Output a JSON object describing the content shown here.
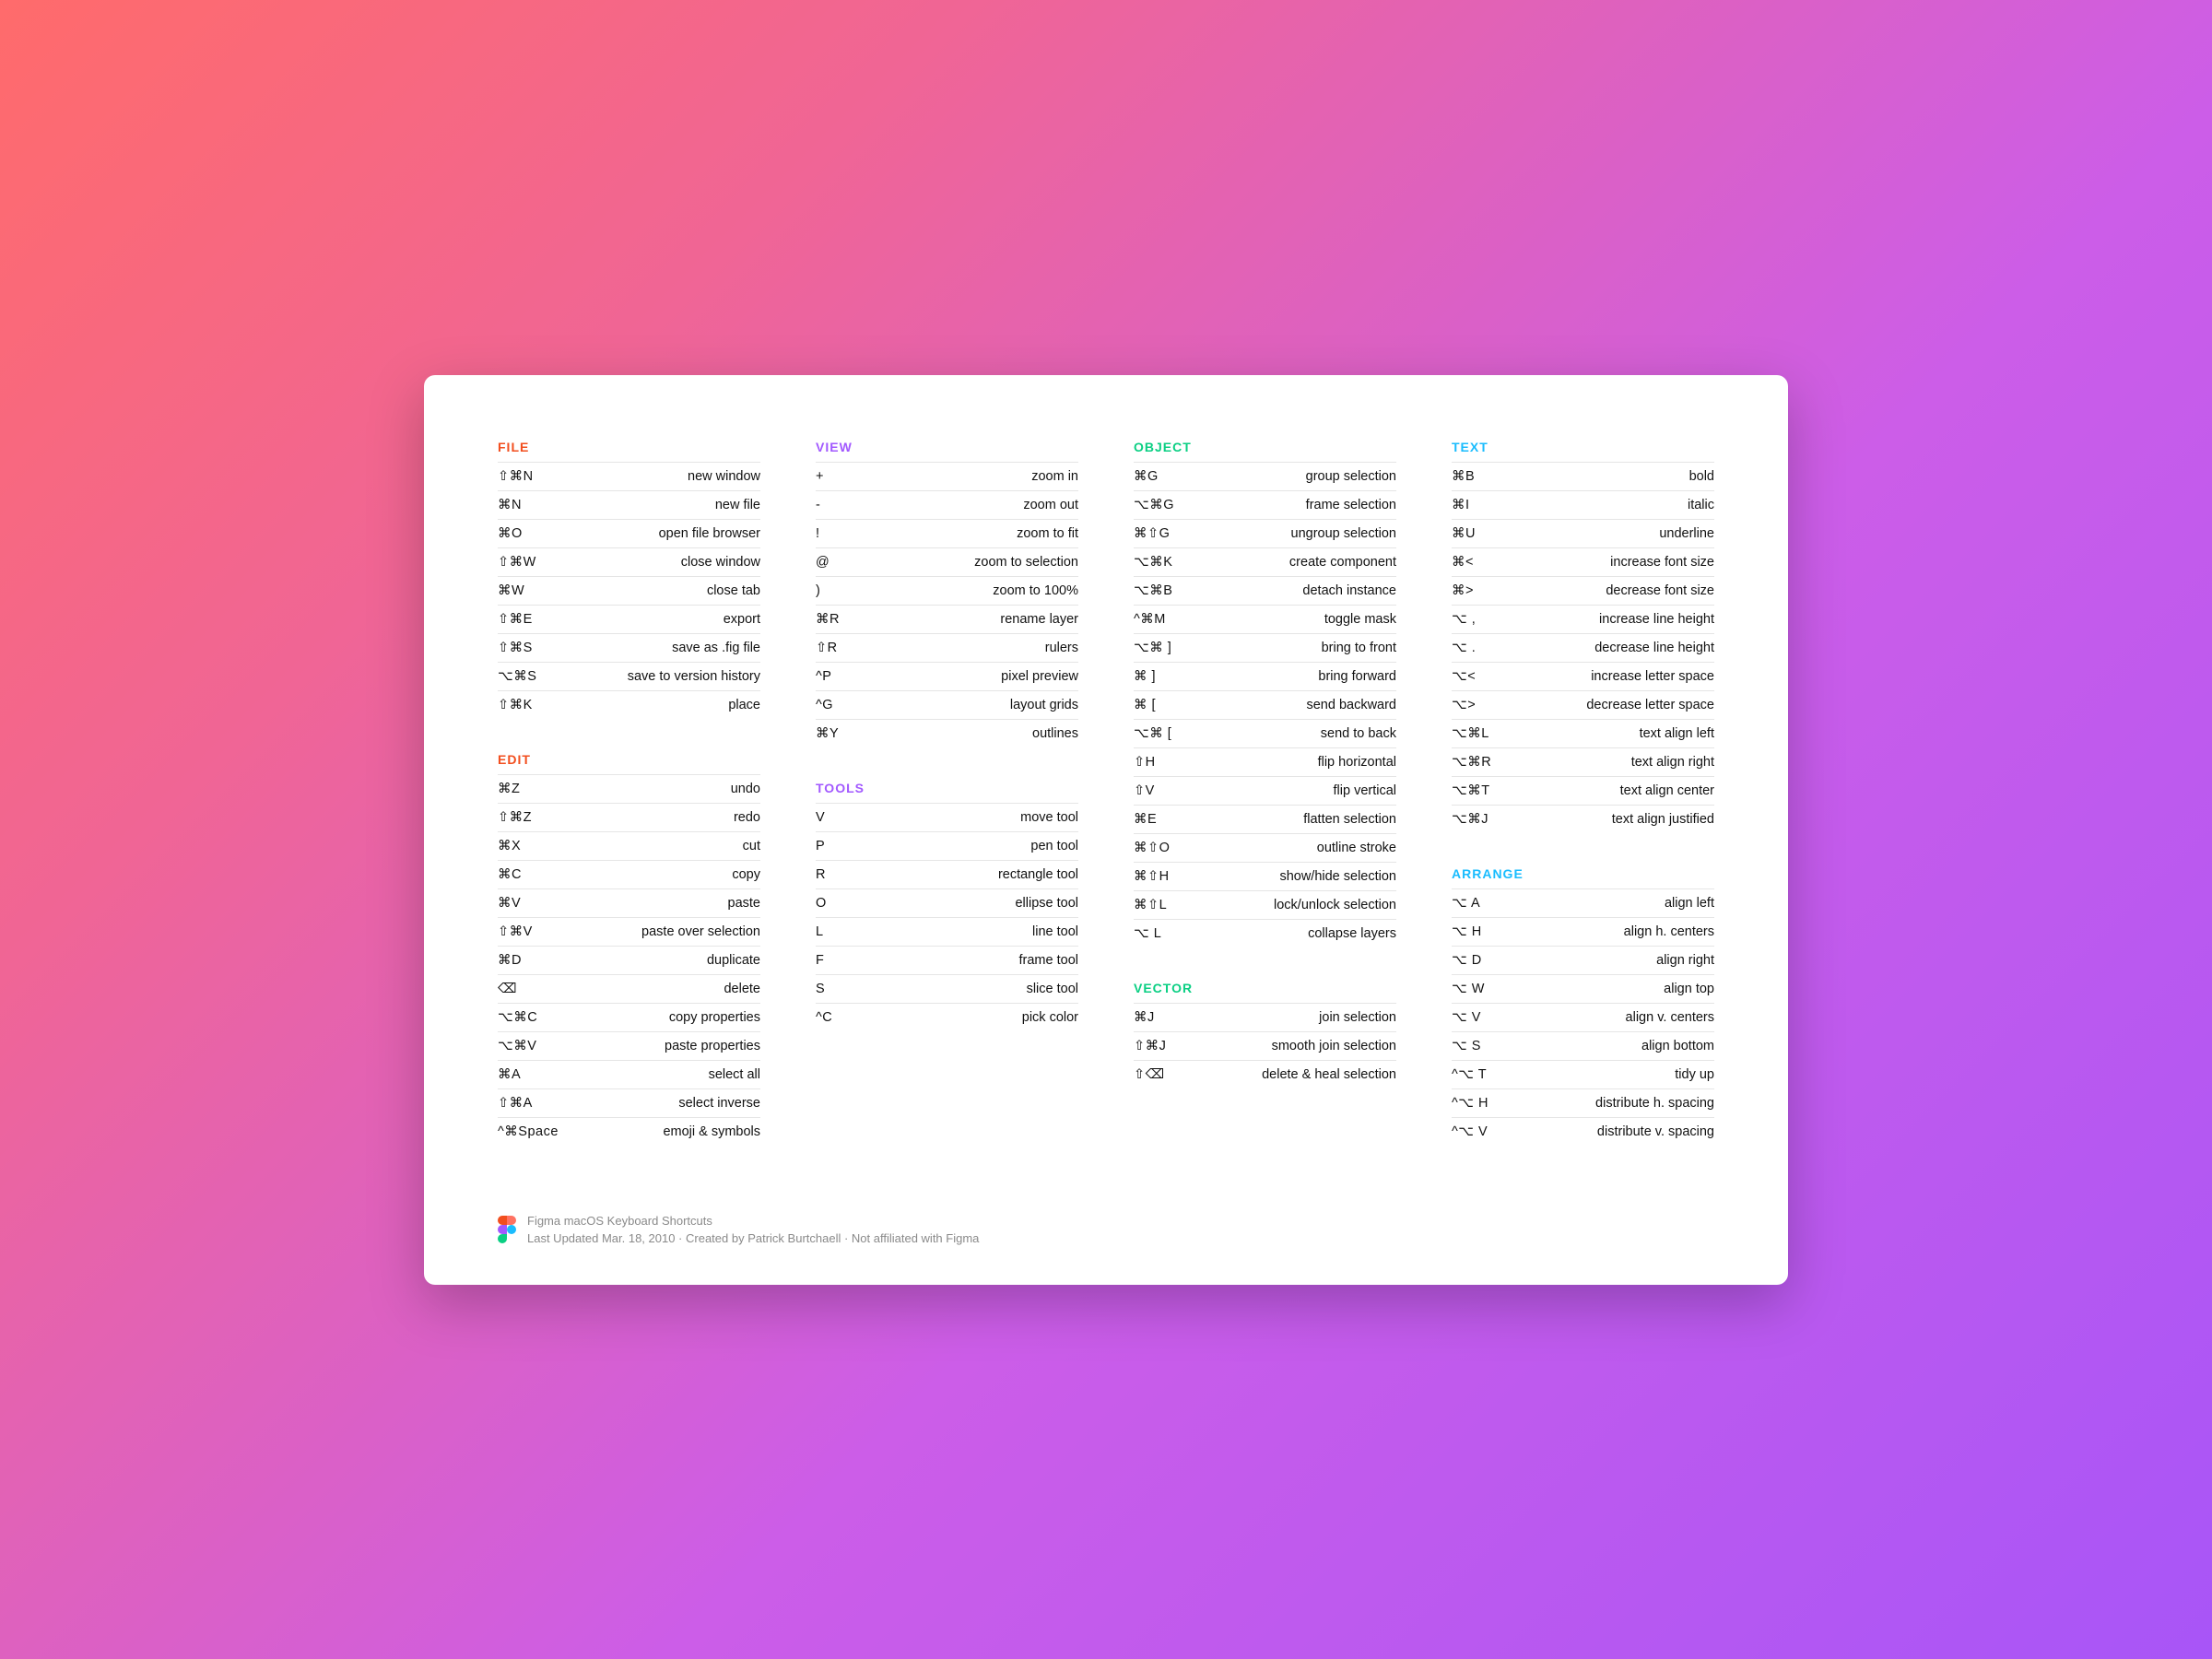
{
  "colors": {
    "orange": "#F24E1E",
    "purple": "#A259FF",
    "green": "#0ACF83",
    "blue": "#1ABCFE"
  },
  "columns": [
    {
      "sections": [
        {
          "title": "FILE",
          "color": "orange",
          "rows": [
            {
              "shortcut": "⇧⌘N",
              "desc": "new window"
            },
            {
              "shortcut": "⌘N",
              "desc": "new file"
            },
            {
              "shortcut": "⌘O",
              "desc": "open file browser"
            },
            {
              "shortcut": "⇧⌘W",
              "desc": "close window"
            },
            {
              "shortcut": "⌘W",
              "desc": "close tab"
            },
            {
              "shortcut": "⇧⌘E",
              "desc": "export"
            },
            {
              "shortcut": "⇧⌘S",
              "desc": "save as .fig file"
            },
            {
              "shortcut": "⌥⌘S",
              "desc": "save to version history"
            },
            {
              "shortcut": "⇧⌘K",
              "desc": "place"
            }
          ]
        },
        {
          "title": "EDIT",
          "color": "orange",
          "rows": [
            {
              "shortcut": "⌘Z",
              "desc": "undo"
            },
            {
              "shortcut": "⇧⌘Z",
              "desc": "redo"
            },
            {
              "shortcut": "⌘X",
              "desc": "cut"
            },
            {
              "shortcut": "⌘C",
              "desc": "copy"
            },
            {
              "shortcut": "⌘V",
              "desc": "paste"
            },
            {
              "shortcut": "⇧⌘V",
              "desc": "paste over selection"
            },
            {
              "shortcut": "⌘D",
              "desc": "duplicate"
            },
            {
              "shortcut": "⌫",
              "desc": "delete"
            },
            {
              "shortcut": "⌥⌘C",
              "desc": "copy properties"
            },
            {
              "shortcut": "⌥⌘V",
              "desc": "paste properties"
            },
            {
              "shortcut": "⌘A",
              "desc": "select all"
            },
            {
              "shortcut": "⇧⌘A",
              "desc": "select inverse"
            },
            {
              "shortcut": "^⌘Space",
              "desc": "emoji & symbols"
            }
          ]
        }
      ]
    },
    {
      "sections": [
        {
          "title": "VIEW",
          "color": "purple",
          "rows": [
            {
              "shortcut": "+",
              "desc": "zoom in"
            },
            {
              "shortcut": "-",
              "desc": "zoom out"
            },
            {
              "shortcut": "!",
              "desc": "zoom to fit"
            },
            {
              "shortcut": "@",
              "desc": "zoom to selection"
            },
            {
              "shortcut": ")",
              "desc": "zoom to 100%"
            },
            {
              "shortcut": "⌘R",
              "desc": "rename layer"
            },
            {
              "shortcut": "⇧R",
              "desc": "rulers"
            },
            {
              "shortcut": "^P",
              "desc": "pixel preview"
            },
            {
              "shortcut": "^G",
              "desc": "layout grids"
            },
            {
              "shortcut": "⌘Y",
              "desc": "outlines"
            }
          ]
        },
        {
          "title": "TOOLS",
          "color": "purple",
          "rows": [
            {
              "shortcut": "V",
              "desc": "move tool"
            },
            {
              "shortcut": "P",
              "desc": "pen tool"
            },
            {
              "shortcut": "R",
              "desc": "rectangle tool"
            },
            {
              "shortcut": "O",
              "desc": "ellipse tool"
            },
            {
              "shortcut": "L",
              "desc": "line tool"
            },
            {
              "shortcut": "F",
              "desc": "frame tool"
            },
            {
              "shortcut": "S",
              "desc": "slice tool"
            },
            {
              "shortcut": "^C",
              "desc": "pick color"
            }
          ]
        }
      ]
    },
    {
      "sections": [
        {
          "title": "OBJECT",
          "color": "green",
          "rows": [
            {
              "shortcut": "⌘G",
              "desc": "group selection"
            },
            {
              "shortcut": "⌥⌘G",
              "desc": "frame selection"
            },
            {
              "shortcut": "⌘⇧G",
              "desc": "ungroup selection"
            },
            {
              "shortcut": "⌥⌘K",
              "desc": "create component"
            },
            {
              "shortcut": "⌥⌘B",
              "desc": "detach instance"
            },
            {
              "shortcut": "^⌘M",
              "desc": "toggle mask"
            },
            {
              "shortcut": "⌥⌘ ]",
              "desc": "bring to front"
            },
            {
              "shortcut": "⌘ ]",
              "desc": "bring forward"
            },
            {
              "shortcut": "⌘ [",
              "desc": "send backward"
            },
            {
              "shortcut": "⌥⌘ [",
              "desc": "send to back"
            },
            {
              "shortcut": "⇧H",
              "desc": "flip horizontal"
            },
            {
              "shortcut": "⇧V",
              "desc": "flip vertical"
            },
            {
              "shortcut": "⌘E",
              "desc": "flatten selection"
            },
            {
              "shortcut": "⌘⇧O",
              "desc": "outline stroke"
            },
            {
              "shortcut": "⌘⇧H",
              "desc": "show/hide selection"
            },
            {
              "shortcut": "⌘⇧L",
              "desc": "lock/unlock selection"
            },
            {
              "shortcut": "⌥ L",
              "desc": "collapse layers"
            }
          ]
        },
        {
          "title": "VECTOR",
          "color": "green",
          "rows": [
            {
              "shortcut": "⌘J",
              "desc": "join selection"
            },
            {
              "shortcut": "⇧⌘J",
              "desc": "smooth join selection"
            },
            {
              "shortcut": "⇧⌫",
              "desc": "delete & heal selection"
            }
          ]
        }
      ]
    },
    {
      "sections": [
        {
          "title": "TEXT",
          "color": "blue",
          "rows": [
            {
              "shortcut": "⌘B",
              "desc": "bold"
            },
            {
              "shortcut": "⌘I",
              "desc": "italic"
            },
            {
              "shortcut": "⌘U",
              "desc": "underline"
            },
            {
              "shortcut": "⌘<",
              "desc": "increase font size"
            },
            {
              "shortcut": "⌘>",
              "desc": "decrease font size"
            },
            {
              "shortcut": "⌥ ,",
              "desc": "increase line height"
            },
            {
              "shortcut": "⌥ .",
              "desc": "decrease line height"
            },
            {
              "shortcut": "⌥<",
              "desc": "increase letter space"
            },
            {
              "shortcut": "⌥>",
              "desc": "decrease letter space"
            },
            {
              "shortcut": "⌥⌘L",
              "desc": "text align left"
            },
            {
              "shortcut": "⌥⌘R",
              "desc": "text align right"
            },
            {
              "shortcut": "⌥⌘T",
              "desc": "text align center"
            },
            {
              "shortcut": "⌥⌘J",
              "desc": "text align justified"
            }
          ]
        },
        {
          "title": "ARRANGE",
          "color": "blue",
          "rows": [
            {
              "shortcut": "⌥ A",
              "desc": "align left"
            },
            {
              "shortcut": "⌥ H",
              "desc": "align h. centers"
            },
            {
              "shortcut": "⌥ D",
              "desc": "align right"
            },
            {
              "shortcut": "⌥ W",
              "desc": "align top"
            },
            {
              "shortcut": "⌥ V",
              "desc": "align v. centers"
            },
            {
              "shortcut": "⌥ S",
              "desc": "align bottom"
            },
            {
              "shortcut": "^⌥ T",
              "desc": "tidy up"
            },
            {
              "shortcut": "^⌥ H",
              "desc": "distribute h. spacing"
            },
            {
              "shortcut": "^⌥ V",
              "desc": "distribute v. spacing"
            }
          ]
        }
      ]
    }
  ],
  "footer": {
    "line1": "Figma macOS Keyboard Shortcuts",
    "line2": "Last Updated Mar. 18, 2010 · Created by Patrick Burtchaell · Not affiliated with Figma"
  }
}
